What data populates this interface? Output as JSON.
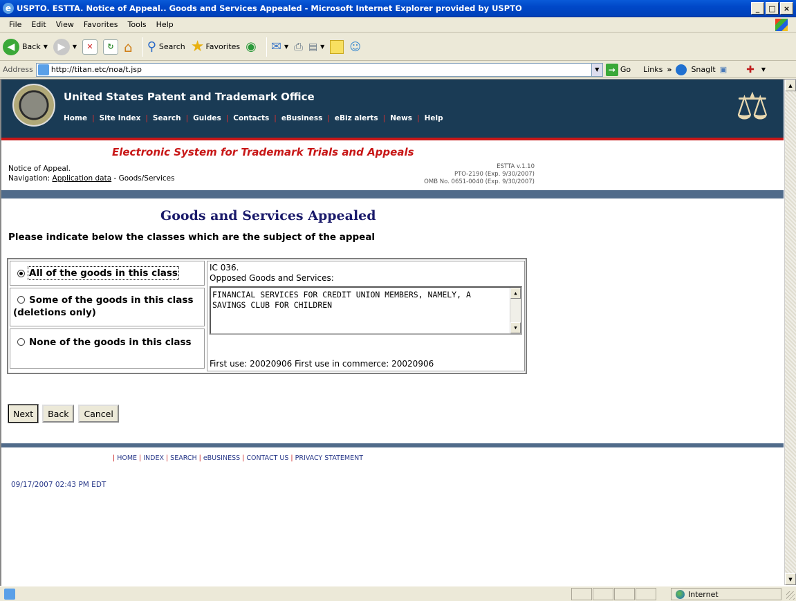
{
  "window": {
    "title": "USPTO. ESTTA. Notice of Appeal.. Goods and Services Appealed - Microsoft Internet Explorer provided by USPTO",
    "min": "_",
    "max": "□",
    "close": "×"
  },
  "menu": [
    "File",
    "Edit",
    "View",
    "Favorites",
    "Tools",
    "Help"
  ],
  "toolbar": {
    "back": "Back",
    "search": "Search",
    "favorites": "Favorites"
  },
  "address": {
    "label": "Address",
    "url": "http://titan.etc/noa/t.jsp",
    "go": "Go",
    "links": "Links",
    "snagit": "SnagIt"
  },
  "banner": {
    "title": "United States Patent and Trademark Office",
    "nav": [
      "Home",
      "Site Index",
      "Search",
      "Guides",
      "Contacts",
      "eBusiness",
      "eBiz alerts",
      "News",
      "Help"
    ]
  },
  "subheader": {
    "title": "Electronic System for Trademark Trials and Appeals",
    "notice": "Notice of Appeal.",
    "nav_prefix": "Navigation: ",
    "nav_link": "Application data",
    "nav_suffix": " - Goods/Services",
    "version": "ESTTA v.1.10",
    "form": "PTO-2190 (Exp. 9/30/2007)",
    "omb": "OMB No. 0651-0040 (Exp. 9/30/2007)"
  },
  "main": {
    "heading": "Goods and Services Appealed",
    "instruction": "Please indicate below the classes which are the subject of the appeal",
    "options": [
      {
        "label": "All of the goods in this class",
        "selected": true
      },
      {
        "label": "Some of the goods in this class (deletions only)",
        "selected": false
      },
      {
        "label": "None of the goods in this class",
        "selected": false
      }
    ],
    "class_code": "IC 036.",
    "goods_label": "Opposed Goods and Services:",
    "goods_text": "FINANCIAL SERVICES FOR CREDIT UNION MEMBERS, NAMELY, A SAVINGS CLUB FOR CHILDREN",
    "first_use": "First use: 20020906 First use in commerce: 20020906"
  },
  "buttons": {
    "next": "Next",
    "back": "Back",
    "cancel": "Cancel"
  },
  "footer": {
    "links": [
      "HOME",
      "INDEX",
      "SEARCH",
      "eBUSINESS",
      "CONTACT US",
      "PRIVACY STATEMENT"
    ],
    "timestamp": "09/17/2007 02:43 PM EDT"
  },
  "status": {
    "zone": "Internet"
  }
}
